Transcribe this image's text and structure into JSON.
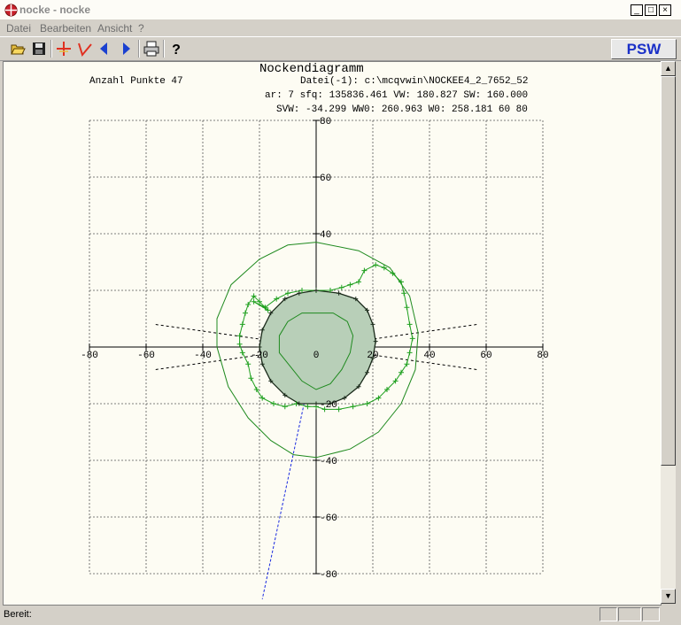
{
  "window": {
    "title": "nocke - nocke",
    "controls": {
      "minimize": "_",
      "maximize": "□",
      "close": "×"
    }
  },
  "menu": {
    "items": [
      "Datei",
      "Bearbeiten",
      "Ansicht",
      "?"
    ]
  },
  "toolbar": {
    "icons": [
      "open-folder-icon",
      "save-disk-icon",
      "crosshair-icon",
      "angle-icon",
      "arrow-left-icon",
      "arrow-right-icon",
      "printer-icon",
      "help-icon"
    ],
    "psw_label": "PSW"
  },
  "diagram": {
    "title": "Nockendiagramm",
    "points_label": "Anzahl Punkte 47",
    "info_line1": "Datei(-1): c:\\mcqvwin\\NOCKEE4_2_7652_52",
    "info_line2": "ar: 7 sfq: 135836.461 VW: 180.827 SW: 160.000",
    "info_line3": "SVW: -34.299 WW0: 260.963 W0: 258.181 60 80"
  },
  "chart_data": {
    "type": "scatter",
    "title": "Nockendiagramm",
    "xlim": [
      -80,
      80
    ],
    "ylim": [
      -80,
      80
    ],
    "grid": true,
    "x_ticks": [
      "-80",
      "-60",
      "-40",
      "-20",
      "0",
      "20",
      "40",
      "60",
      "80"
    ],
    "y_ticks": [
      "80",
      "60",
      "40",
      "-20",
      "-40",
      "-60",
      "-80"
    ],
    "x_tick_values": [
      -80,
      -60,
      -40,
      -20,
      0,
      20,
      40,
      60,
      80
    ],
    "y_tick_values": [
      80,
      60,
      40,
      -20,
      -40,
      -60,
      -80
    ],
    "colors": {
      "outer": "#1f8a1f",
      "fill": "#b8cfb8",
      "plus_green": "#1fa01f",
      "plus_black": "#1a2a1a",
      "dash_blue": "#1a2ae0"
    },
    "series": [
      {
        "values": [
          [
            0,
            37
          ],
          [
            15,
            34
          ],
          [
            26,
            28
          ],
          [
            33,
            18
          ],
          [
            36,
            5
          ],
          [
            35,
            -8
          ],
          [
            30,
            -20
          ],
          [
            22,
            -30
          ],
          [
            12,
            -36
          ],
          [
            0,
            -39
          ],
          [
            -8,
            -38
          ],
          [
            -16,
            -33
          ],
          [
            -24,
            -25
          ],
          [
            -31,
            -14
          ],
          [
            -35,
            0
          ],
          [
            -35,
            10
          ],
          [
            -30,
            22
          ],
          [
            -20,
            31
          ],
          [
            -10,
            36
          ],
          [
            0,
            37
          ]
        ]
      },
      {
        "values": [
          [
            -22,
            16
          ],
          [
            -18,
            14
          ],
          [
            -14,
            17
          ],
          [
            -10,
            19
          ],
          [
            -5,
            20
          ],
          [
            0,
            20
          ],
          [
            5,
            20
          ],
          [
            9,
            21
          ],
          [
            12,
            22
          ],
          [
            15,
            23
          ],
          [
            17,
            27
          ],
          [
            21,
            29
          ],
          [
            24,
            28
          ],
          [
            27,
            26
          ],
          [
            30,
            23
          ],
          [
            31,
            19
          ],
          [
            32,
            14
          ],
          [
            33,
            8
          ],
          [
            34,
            3
          ],
          [
            33,
            -2
          ],
          [
            32,
            -6
          ],
          [
            30,
            -9
          ],
          [
            28,
            -12
          ],
          [
            25,
            -15
          ],
          [
            22,
            -18
          ],
          [
            18,
            -20
          ],
          [
            13,
            -21
          ],
          [
            8,
            -22
          ],
          [
            3,
            -22
          ],
          [
            0,
            -21
          ],
          [
            -3,
            -21
          ],
          [
            -7,
            -20
          ],
          [
            -11,
            -21
          ],
          [
            -15,
            -20
          ],
          [
            -19,
            -18
          ],
          [
            -21,
            -15
          ],
          [
            -23,
            -11
          ],
          [
            -24,
            -6
          ],
          [
            -26,
            -2
          ],
          [
            -27,
            1
          ],
          [
            -27,
            4
          ],
          [
            -26,
            8
          ],
          [
            -25,
            12
          ],
          [
            -24,
            15
          ],
          [
            -22,
            18
          ],
          [
            -20,
            16
          ],
          [
            -17,
            13
          ]
        ]
      },
      {
        "values": [
          [
            0,
            20
          ],
          [
            8,
            19
          ],
          [
            14,
            17
          ],
          [
            18,
            13
          ],
          [
            20,
            8
          ],
          [
            21,
            2
          ],
          [
            20,
            -4
          ],
          [
            18,
            -9
          ],
          [
            15,
            -14
          ],
          [
            10,
            -18
          ],
          [
            5,
            -20
          ],
          [
            0,
            -20
          ],
          [
            -6,
            -20
          ],
          [
            -11,
            -17
          ],
          [
            -16,
            -12
          ],
          [
            -19,
            -6
          ],
          [
            -20,
            0
          ],
          [
            -19,
            6
          ],
          [
            -16,
            12
          ],
          [
            -11,
            17
          ],
          [
            -6,
            19
          ],
          [
            0,
            20
          ]
        ]
      },
      {
        "values": [
          [
            0,
            12
          ],
          [
            6,
            12
          ],
          [
            11,
            9
          ],
          [
            13,
            4
          ],
          [
            12,
            -2
          ],
          [
            9,
            -8
          ],
          [
            5,
            -13
          ],
          [
            0,
            -15
          ],
          [
            -5,
            -12
          ],
          [
            -9,
            -7
          ],
          [
            -13,
            -2
          ],
          [
            -13,
            4
          ],
          [
            -10,
            9
          ],
          [
            -5,
            12
          ],
          [
            0,
            12
          ]
        ]
      }
    ]
  },
  "scrollbar": {
    "up": "▲",
    "down": "▼"
  },
  "status": {
    "text": "Bereit:"
  }
}
